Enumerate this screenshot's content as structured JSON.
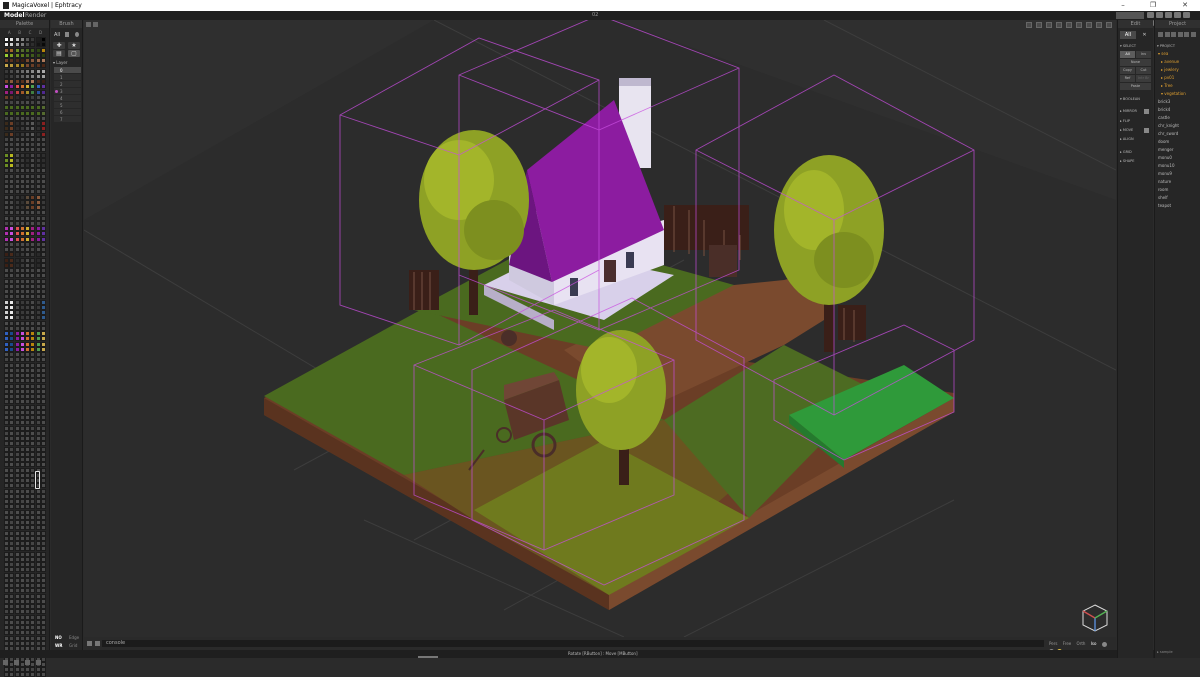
{
  "window": {
    "title": "MagicaVoxel | Ephtracy",
    "controls": [
      "–",
      "❐",
      "✕"
    ]
  },
  "menu": {
    "model": "Model",
    "render": "Render",
    "file_number": "02"
  },
  "palette": {
    "title": "Palette",
    "letters": [
      "A",
      "B",
      "C",
      "D"
    ],
    "bottom_label": "▾ color"
  },
  "brush": {
    "title": "Brush",
    "tab_all": "All",
    "tools": [
      "✚",
      "★",
      "▤",
      "▢"
    ],
    "layer_header": "▾ Layer",
    "layers": [
      "0",
      "1",
      "2",
      "3",
      "4",
      "5",
      "6",
      "7"
    ],
    "active_layer": "0",
    "modes": [
      {
        "key": "NO",
        "value": "Edge"
      },
      {
        "key": "WR",
        "value": "Grid"
      },
      {
        "key": "SW",
        "value": "Frame"
      }
    ]
  },
  "edit": {
    "title": "Edit",
    "tab_all": "All",
    "select_header": "▾ SELECT",
    "buttons": [
      "All",
      "Inv",
      "None",
      "Copy",
      "Cut",
      "Ref",
      "Intr Br",
      "Paste"
    ],
    "sections": [
      "▾ BOOLEAN",
      "▸ MIRROR",
      "▸ FLIP",
      "▸ MOVE",
      "▸ ALIGN",
      "▸ GRID",
      "▸ SHAPE"
    ]
  },
  "project": {
    "title": "Project",
    "header": "▾ PROJECT",
    "tree": [
      {
        "label": "▾ sea",
        "type": "folder",
        "level": 0
      },
      {
        "label": "▸ avenue",
        "type": "folder",
        "level": 1
      },
      {
        "label": "▸ jewlery",
        "type": "folder",
        "level": 1
      },
      {
        "label": "▸ pv01",
        "type": "folder",
        "level": 1
      },
      {
        "label": "▸ Tree",
        "type": "folder",
        "level": 1
      },
      {
        "label": "▾ vegetation",
        "type": "folder",
        "level": 1
      },
      {
        "label": "brick3",
        "type": "file",
        "level": 2
      },
      {
        "label": "brick4",
        "type": "file",
        "level": 2
      },
      {
        "label": "castle",
        "type": "file",
        "level": 2
      },
      {
        "label": "chr_knight",
        "type": "file",
        "level": 2
      },
      {
        "label": "chr_sword",
        "type": "file",
        "level": 2
      },
      {
        "label": "doom",
        "type": "file",
        "level": 2
      },
      {
        "label": "menger",
        "type": "file",
        "level": 2
      },
      {
        "label": "monu0",
        "type": "file",
        "level": 2
      },
      {
        "label": "monu10",
        "type": "file",
        "level": 2
      },
      {
        "label": "monu9",
        "type": "file",
        "level": 2
      },
      {
        "label": "nature",
        "type": "file",
        "level": 2
      },
      {
        "label": "room",
        "type": "file",
        "level": 2
      },
      {
        "label": "shelf",
        "type": "file",
        "level": 2
      },
      {
        "label": "teapot",
        "type": "file",
        "level": 2
      }
    ],
    "bottom_label": "▸ sample"
  },
  "viewport": {
    "console_placeholder": "console",
    "view_modes": [
      "Pers",
      "Free",
      "Orth",
      "Iso"
    ],
    "active_view_mode": "Iso"
  },
  "status": {
    "text": "Rotate [RButton] : Move [MButton]"
  },
  "colors": {
    "accent": "#5b9bd5",
    "bounds": "#c94ee0",
    "grass": "#4a6a1f",
    "roof": "#8c1ca0",
    "dirt": "#7a4a2e",
    "foliage": "#a3b52a"
  }
}
